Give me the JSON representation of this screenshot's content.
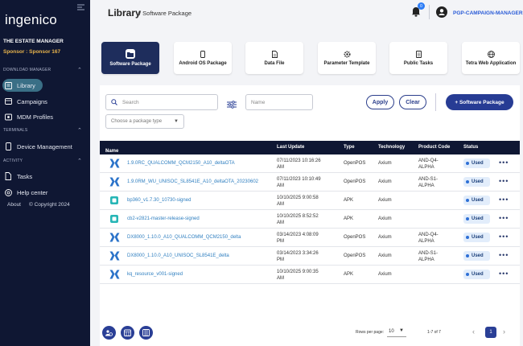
{
  "sidebar": {
    "logo": "ingenico",
    "estate": "THE ESTATE MANAGER",
    "sponsor": "Sponsor : Sponsor 167",
    "sections": {
      "download_manager": "DOWNLOAD MANAGER",
      "terminals": "TERMINALS",
      "activity": "ACTIVITY"
    },
    "items": {
      "library": "Library",
      "campaigns": "Campaigns",
      "mdm_profiles": "MDM Profiles",
      "device_management": "Device Management",
      "tasks": "Tasks",
      "help_center": "Help center"
    },
    "about": "About",
    "copyright": "© Copyright 2024"
  },
  "header": {
    "title": "Library",
    "breadcrumb": "/ Software Package",
    "notifications_count": "0",
    "user": "PGP-CAMPAIGN-MANAGER"
  },
  "tabs": [
    {
      "label": "Software Package",
      "icon": "folder-icon",
      "active": true
    },
    {
      "label": "Android OS Package",
      "icon": "phone-icon",
      "active": false
    },
    {
      "label": "Data File",
      "icon": "file-icon",
      "active": false
    },
    {
      "label": "Parameter Template",
      "icon": "settings-icon",
      "active": false
    },
    {
      "label": "Public Tasks",
      "icon": "document-icon",
      "active": false
    },
    {
      "label": "Tetra Web Application",
      "icon": "globe-icon",
      "active": false
    }
  ],
  "filters": {
    "search_placeholder": "Search",
    "name_placeholder": "Name",
    "package_type_placeholder": "Choose a package type",
    "apply": "Apply",
    "clear": "Clear",
    "add_package": "+ Software Package"
  },
  "table": {
    "headers": {
      "name": "Name",
      "sort": "↑",
      "last_update": "Last Update",
      "type": "Type",
      "technology": "Technology",
      "product_code": "Product Code",
      "status": "Status"
    },
    "rows": [
      {
        "name": "1.9.0RC_QUALCOMM_QCM2150_A10_deltaOTA",
        "update1": "07/11/2023 10:16:26",
        "update2": "AM",
        "type": "OpenPOS",
        "tech": "Axium",
        "prod1": "AND-Q4-",
        "prod2": "ALPHA",
        "status": "Used",
        "icon": "ingenico-logo-icon"
      },
      {
        "name": "1.9.0RM_WU_UNISOC_SL8541E_A10_deltaOTA_20230602",
        "update1": "07/11/2023 10:10:49",
        "update2": "AM",
        "type": "OpenPOS",
        "tech": "Axium",
        "prod1": "AND-S1-",
        "prod2": "ALPHA",
        "status": "Used",
        "icon": "ingenico-logo-icon"
      },
      {
        "name": "bp360_v1.7.30_10730-signed",
        "update1": "10/10/2025 9:00:58",
        "update2": "AM",
        "type": "APK",
        "tech": "Axium",
        "prod1": "",
        "prod2": "",
        "status": "Used",
        "icon": "app-icon"
      },
      {
        "name": "cb2-v2821-master-release-signed",
        "update1": "10/10/2025 8:52:52",
        "update2": "AM",
        "type": "APK",
        "tech": "Axium",
        "prod1": "",
        "prod2": "",
        "status": "Used",
        "icon": "app-icon"
      },
      {
        "name": "DX8000_1.10.0_A10_QUALCOMM_QCM2150_delta",
        "update1": "03/14/2023 4:08:09",
        "update2": "PM",
        "type": "OpenPOS",
        "tech": "Axium",
        "prod1": "AND-Q4-",
        "prod2": "ALPHA",
        "status": "Used",
        "icon": "ingenico-logo-icon"
      },
      {
        "name": "DX8000_1.10.0_A10_UNISOC_SL8541E_delta",
        "update1": "03/14/2023 3:34:26",
        "update2": "PM",
        "type": "OpenPOS",
        "tech": "Axium",
        "prod1": "AND-S1-",
        "prod2": "ALPHA",
        "status": "Used",
        "icon": "ingenico-logo-icon"
      },
      {
        "name": "kq_resource_v001-signed",
        "update1": "10/10/2025 9:00:35",
        "update2": "AM",
        "type": "APK",
        "tech": "Axium",
        "prod1": "",
        "prod2": "",
        "status": "Used",
        "icon": "ingenico-logo-icon"
      }
    ]
  },
  "pagination": {
    "rows_per_page_label": "Rows per page:",
    "rows_per_page": "10",
    "range": "1-7 of 7",
    "page": "1"
  },
  "colors": {
    "sidebar_bg": "#0f1733",
    "accent": "#273c94",
    "link": "#2f7fc0",
    "status_bg": "#e2edfb"
  }
}
